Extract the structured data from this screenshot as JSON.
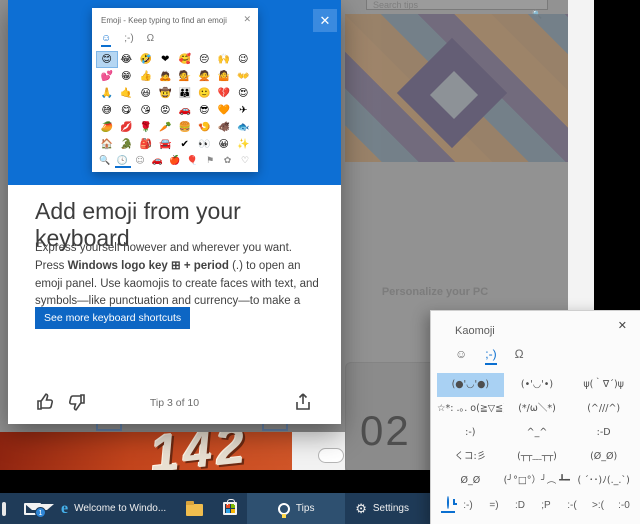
{
  "tip_dialog": {
    "close_glyph": "✕",
    "emoji_flyout": {
      "title": "Emoji - Keep typing to find an emoji",
      "close_glyph": "✕",
      "tabs": [
        "☺",
        ";-)",
        "Ω"
      ],
      "active_tab_index": 0,
      "grid": [
        [
          "😊",
          "😂",
          "🤣",
          "❤",
          "🥰",
          "😔",
          "🙌",
          "😉"
        ],
        [
          "💕",
          "😁",
          "👍",
          "🙇",
          "💁",
          "🙅",
          "🤷",
          "👐"
        ],
        [
          "🙏",
          "🤙",
          "😃",
          "🤠",
          "👪",
          "🙂",
          "💔",
          "😍"
        ],
        [
          "😅",
          "😋",
          "😘",
          "😡",
          "🚗",
          "😎",
          "🧡",
          "✈"
        ],
        [
          "🥭",
          "💋",
          "🌹",
          "🥕",
          "🍔",
          "🍤",
          "🐗",
          "🐟"
        ],
        [
          "🏠",
          "🐊",
          "🎒",
          "🚘",
          "✔",
          "👀",
          "😀",
          "✨"
        ]
      ],
      "category_icons": [
        "🔍",
        "🕓",
        "☺",
        "🚗",
        "🍎",
        "🎈",
        "⚑",
        "✿",
        "♡"
      ],
      "active_category_index": 1
    },
    "headline": "Add emoji from your keyboard",
    "body": {
      "part1": "Express yourself however and wherever you want. Press ",
      "bold1": "Windows logo key",
      "win_glyph": "⊞",
      "plus": " + ",
      "bold2": "period",
      "part2": " (.) to open an emoji panel. Use kaomojis to create faces with text, and symbols—like punctuation and currency—to make a statement."
    },
    "cta_label": "See more keyboard shortcuts",
    "footer": {
      "tip_counter": "Tip 3 of 10"
    }
  },
  "kaomoji_panel": {
    "title": "Kaomoji",
    "close_glyph": "✕",
    "tabs": [
      "☺",
      ";-)",
      "Ω"
    ],
    "active_tab_index": 1,
    "grid": [
      [
        "(●'◡'●)",
        "(•'◡'•)",
        "ψ(｀∇´)ψ"
      ],
      [
        "☆*: .｡. o(≧▽≦)o .｡. :*☆",
        "(*/ω＼*)",
        "(^///^)"
      ],
      [
        ":-)",
        "^_^",
        ":-D"
      ],
      [
        "くコ:彡",
        "(┬┬﹏┬┬)",
        "(Ø_Ø)"
      ],
      [
        "Ø_Ø",
        "(╯°□°）╯︵ ┻━┻",
        "( ´･･)ﾉ(._.`)"
      ]
    ],
    "category_labels": [
      ":-)",
      "=)",
      ":D",
      ";P",
      ":-(",
      ">:(",
      ":-0"
    ]
  },
  "background": {
    "search_placeholder": "Search tips",
    "personalize_title": "Personalize your PC",
    "clock_number": "02",
    "photo_numbers": "142"
  },
  "taskbar": {
    "edge_label": "Welcome to Windo...",
    "tips_label": "Tips",
    "settings_label": "Settings",
    "mail_badge": "1",
    "edge_letter": "e"
  },
  "colors": {
    "accent_blue": "#0d6fd4",
    "cta_blue": "#0d66c4",
    "selected_cell_blue": "#a9d1f3",
    "taskbar_navy": "#1f3b58",
    "photo_red": "#c2441c"
  }
}
